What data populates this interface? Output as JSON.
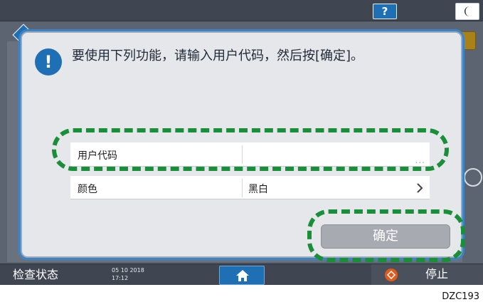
{
  "topbar": {
    "help_label": "?"
  },
  "dialog": {
    "info_icon_glyph": "!",
    "message": "要使用下列功能，请输入用户代码，然后按[确定]。",
    "rows": [
      {
        "label": "用户代码",
        "value": "",
        "trailing": "..."
      },
      {
        "label": "颜色",
        "value": "黑白",
        "trailing": "chevron-right-icon"
      }
    ],
    "ok_button": "确定"
  },
  "bottombar": {
    "status_label": "检查状态",
    "date": "05 10 2018",
    "time": "17:12",
    "stop_label": "停止"
  },
  "caption": "DZC193",
  "colors": {
    "accent": "#1f6fb5",
    "highlight_dash": "#1a8f3a",
    "stop": "#e25b1a",
    "ok_disabled": "#a7abb1"
  }
}
